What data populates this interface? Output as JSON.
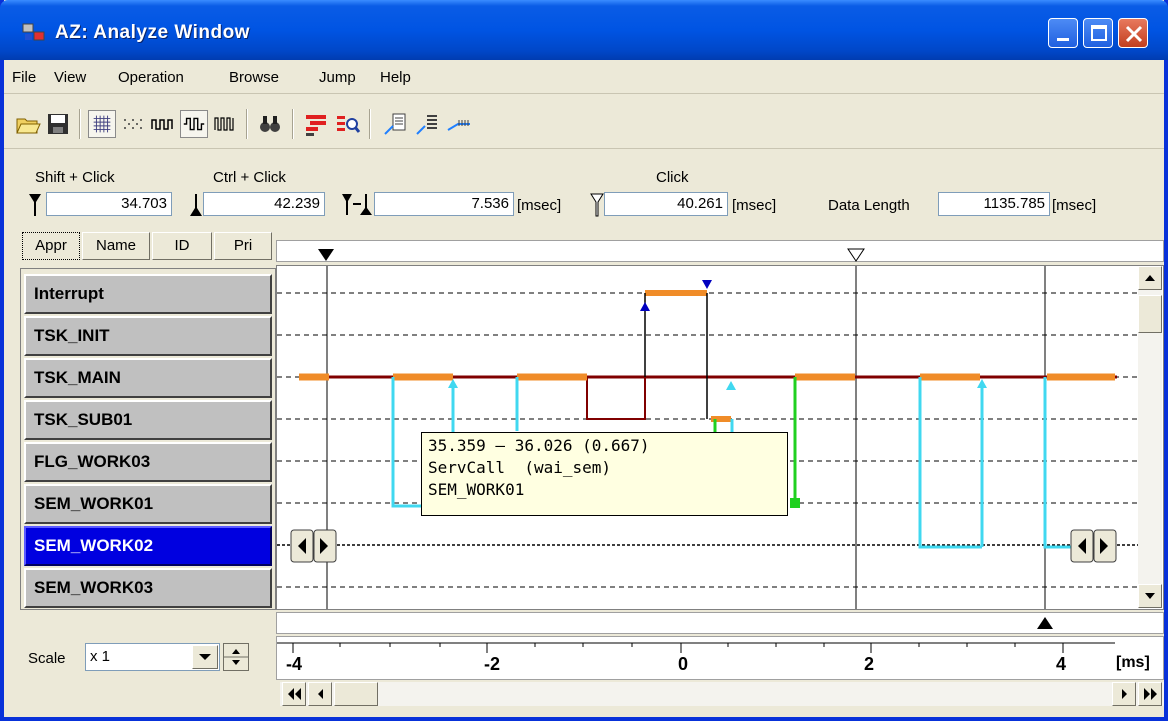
{
  "window": {
    "title": "AZ: Analyze Window"
  },
  "menu": [
    "File",
    "View",
    "Operation",
    "Browse",
    "Jump",
    "Help"
  ],
  "toolbar_icons": [
    "open-icon",
    "save-icon",
    "grid-icon",
    "dots-icon",
    "pulse-icon",
    "pulse2-icon",
    "pulse3-icon",
    "find-icon",
    "bars-icon",
    "zoom-icon",
    "jump-up-icon",
    "jump-up2-icon",
    "jump-right-icon"
  ],
  "cursors": {
    "shift_label": "Shift + Click",
    "shift_value": "34.703",
    "ctrl_label": "Ctrl + Click",
    "ctrl_value": "42.239",
    "diff_value": "7.536",
    "diff_unit": "[msec]",
    "click_label": "Click",
    "click_value": "40.261",
    "click_unit": "[msec]",
    "data_length_label": "Data Length",
    "data_length_value": "1135.785",
    "data_length_unit": "[msec]"
  },
  "tabs": [
    "Appr",
    "Name",
    "ID",
    "Pri"
  ],
  "tasks": [
    "Interrupt",
    "TSK_INIT",
    "TSK_MAIN",
    "TSK_SUB01",
    "FLG_WORK03",
    "SEM_WORK01",
    "SEM_WORK02",
    "SEM_WORK03"
  ],
  "selected_task": "SEM_WORK02",
  "tooltip": {
    "line1": "35.359 – 36.026 (0.667)",
    "line2": "ServCall  (wai_sem)",
    "line3": "SEM_WORK01"
  },
  "scale": {
    "label": "Scale",
    "value": "x 1"
  },
  "axis": {
    "ticks": [
      "-4",
      "-2",
      "0",
      "2",
      "4"
    ],
    "unit": "[ms]"
  },
  "colors": {
    "run": "#f08c28",
    "ready": "#800000",
    "wait": "#40d8f0",
    "sync": "#20d020",
    "marker": "#0000c0"
  }
}
